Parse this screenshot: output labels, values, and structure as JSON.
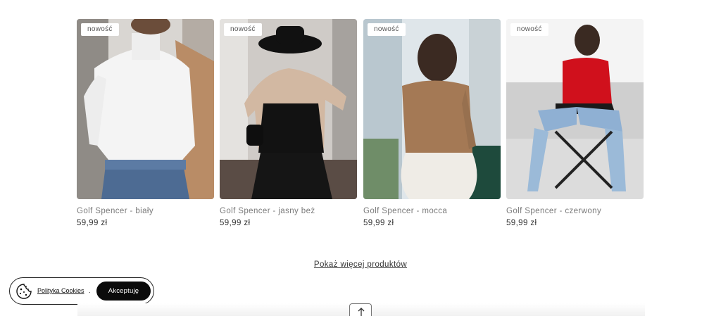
{
  "products": [
    {
      "badge": "nowość",
      "name": "Golf Spencer - biały",
      "price": "59,99 zł",
      "photo": "model-white-turtleneck"
    },
    {
      "badge": "nowość",
      "name": "Golf Spencer - jasny beż",
      "price": "59,99 zł",
      "photo": "model-beige-turtleneck"
    },
    {
      "badge": "nowość",
      "name": "Golf Spencer - mocca",
      "price": "59,99 zł",
      "photo": "model-mocca-bodysuit"
    },
    {
      "badge": "nowość",
      "name": "Golf Spencer - czerwony",
      "price": "59,99 zł",
      "photo": "model-red-turtleneck"
    }
  ],
  "more_link": "Pokaż więcej produktów",
  "cookie_bar": {
    "policy_label": "Polityka Cookies",
    "separator": ".",
    "accept_label": "Akceptuję",
    "icon": "cookie-icon"
  },
  "scroll_top": {
    "icon": "arrow-up-icon"
  },
  "colors": {
    "accent": "#0b0b0b",
    "text": "#333333",
    "muted": "#7a7a7a"
  }
}
